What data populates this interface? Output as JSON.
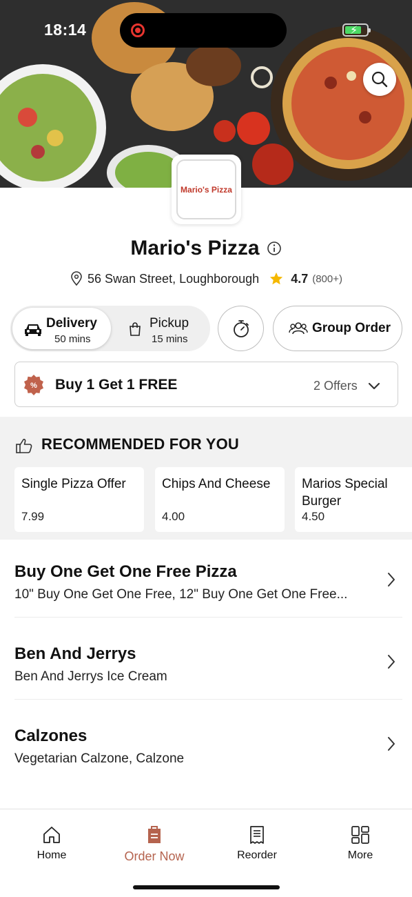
{
  "status_bar": {
    "time": "18:14",
    "battery_level": 0.75
  },
  "restaurant": {
    "logo_text": "Mario's Pizza",
    "name": "Mario's Pizza",
    "address": "56 Swan Street, Loughborough",
    "rating": "4.7",
    "rating_count": "(800+)"
  },
  "order_mode": {
    "delivery_label": "Delivery",
    "delivery_time": "50 mins",
    "pickup_label": "Pickup",
    "pickup_time": "15 mins",
    "selected": "Delivery",
    "group_order_label": "Group Order"
  },
  "offer": {
    "title": "Buy 1 Get 1 FREE",
    "count_label": "2 Offers"
  },
  "recommended": {
    "heading": "RECOMMENDED FOR YOU",
    "items": [
      {
        "name": "Single Pizza Offer",
        "price": "7.99"
      },
      {
        "name": "Chips And Cheese",
        "price": "4.00"
      },
      {
        "name": "Marios Special Burger",
        "price": "4.50"
      }
    ]
  },
  "categories": [
    {
      "title": "Buy One Get One Free Pizza",
      "subtitle": "10\" Buy One Get One Free, 12\" Buy One Get One Free..."
    },
    {
      "title": "Ben And Jerrys",
      "subtitle": "Ben And Jerrys Ice Cream"
    },
    {
      "title": "Calzones",
      "subtitle": "Vegetarian Calzone, Calzone"
    }
  ],
  "bottom_nav": {
    "items": [
      {
        "label": "Home",
        "icon": "home-icon"
      },
      {
        "label": "Order Now",
        "icon": "order-icon"
      },
      {
        "label": "Reorder",
        "icon": "receipt-icon"
      },
      {
        "label": "More",
        "icon": "grid-icon"
      }
    ],
    "active": "Order Now"
  },
  "colors": {
    "accent": "#b5634e",
    "star": "#f5b800",
    "offer_badge": "#c0624c"
  }
}
